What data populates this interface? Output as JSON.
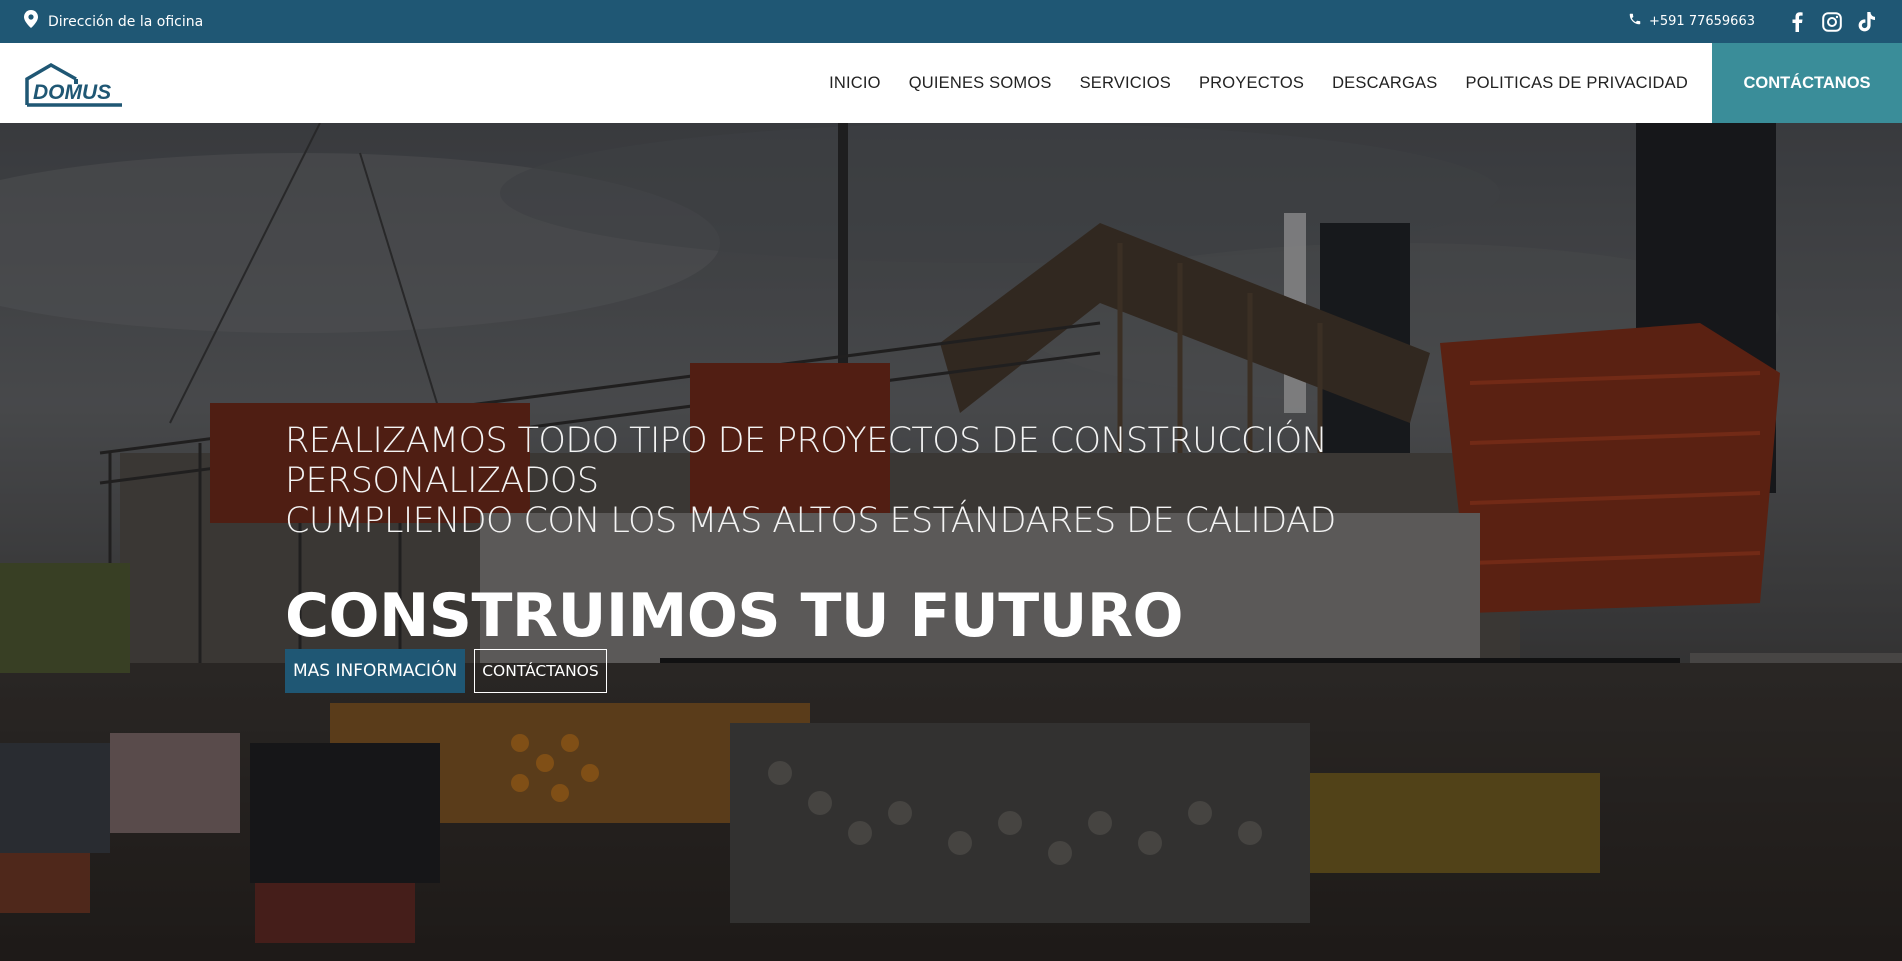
{
  "topbar": {
    "address": "Dirección de la oficina",
    "phone": "+591 77659663",
    "background_color": "#1f5774",
    "icons": [
      "location-pin-icon",
      "phone-icon",
      "facebook-icon",
      "instagram-icon",
      "tiktok-icon"
    ]
  },
  "nav": {
    "logo_text": "DOMUS",
    "items": [
      {
        "label": "INICIO"
      },
      {
        "label": "QUIENES SOMOS"
      },
      {
        "label": "SERVICIOS"
      },
      {
        "label": "PROYECTOS"
      },
      {
        "label": "DESCARGAS"
      },
      {
        "label": "POLITICAS DE PRIVACIDAD"
      }
    ],
    "cta_label": "CONTÁCTANOS",
    "cta_color": "#3a8d99"
  },
  "hero": {
    "subtitle_line1": "REALIZAMOS TODO TIPO DE PROYECTOS DE CONSTRUCCIÓN PERSONALIZADOS",
    "subtitle_line2": "CUMPLIENDO CON LOS MAS ALTOS ESTÁNDARES DE CALIDAD",
    "title": "CONSTRUIMOS TU FUTURO",
    "primary_button": "MAS INFORMACIÓN",
    "secondary_button": "CONTÁCTANOS",
    "background": "construction site photo"
  }
}
